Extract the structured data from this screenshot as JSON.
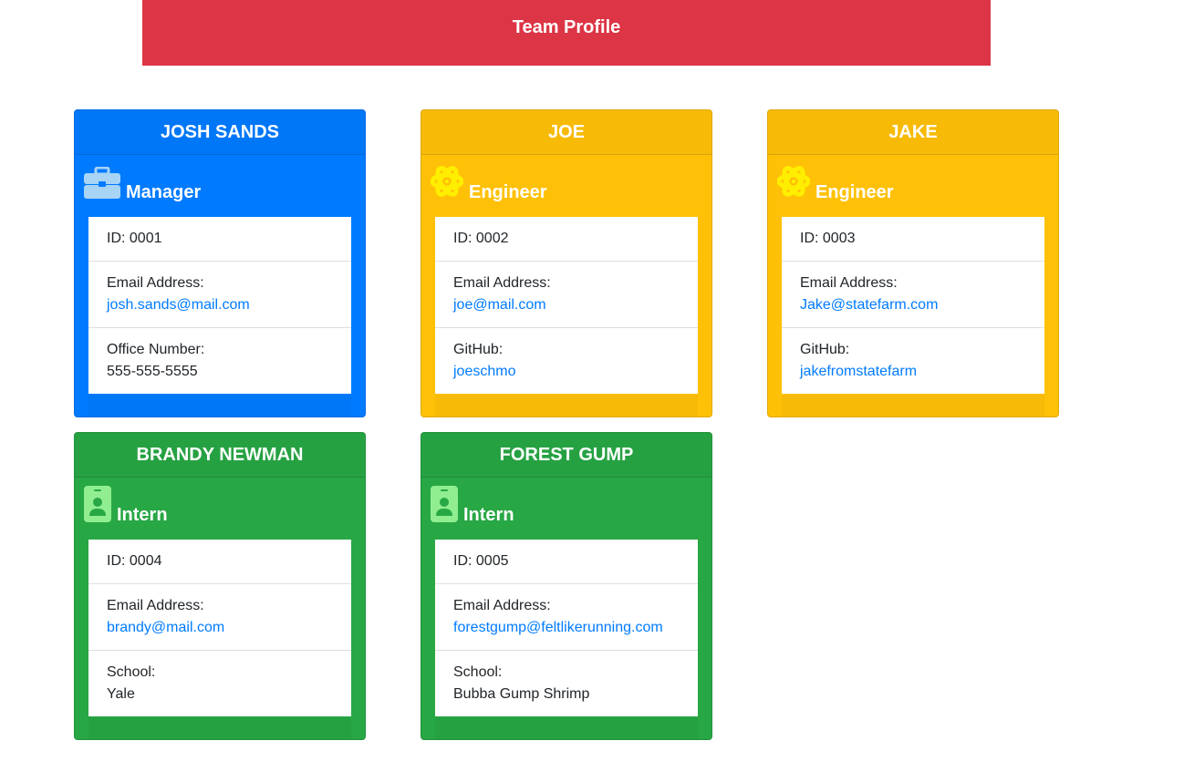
{
  "header": {
    "title": "Team Profile"
  },
  "members": [
    {
      "name": "JOSH SANDS",
      "role": "Manager",
      "icon": "briefcase-icon",
      "id_text": "ID: 0001",
      "email_label": "Email Address:",
      "email": "josh.sands@mail.com",
      "extra_label": "Office Number:",
      "extra_value": "555-555-5555",
      "color": "#007bff"
    },
    {
      "name": "JOE",
      "role": "Engineer",
      "icon": "atom-icon",
      "id_text": "ID: 0002",
      "email_label": "Email Address:",
      "email": "joe@mail.com",
      "extra_label": "GitHub:",
      "extra_value": "joeschmo",
      "color": "#ffc107"
    },
    {
      "name": "JAKE",
      "role": "Engineer",
      "icon": "atom-icon",
      "id_text": "ID: 0003",
      "email_label": "Email Address:",
      "email": "Jake@statefarm.com",
      "extra_label": "GitHub:",
      "extra_value": "jakefromstatefarm",
      "color": "#ffc107"
    },
    {
      "name": "BRANDY NEWMAN",
      "role": "Intern",
      "icon": "id-badge-icon",
      "id_text": "ID: 0004",
      "email_label": "Email Address:",
      "email": "brandy@mail.com",
      "extra_label": "School:",
      "extra_value": "Yale",
      "color": "#28a745"
    },
    {
      "name": "FOREST GUMP",
      "role": "Intern",
      "icon": "id-badge-icon",
      "id_text": "ID: 0005",
      "email_label": "Email Address:",
      "email": "forestgump@feltlikerunning.com",
      "extra_label": "School:",
      "extra_value": "Bubba Gump Shrimp",
      "color": "#28a745"
    }
  ],
  "colors": {
    "banner": "#dc3545",
    "manager": "#007bff",
    "engineer": "#ffc107",
    "intern": "#28a745",
    "link": "#007bff"
  }
}
